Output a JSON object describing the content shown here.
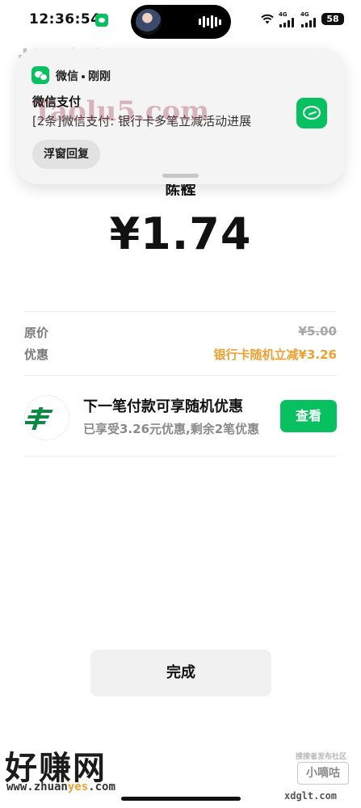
{
  "status_bar": {
    "time": "12:36:54",
    "battery": "58",
    "network_1": "4G",
    "network_2": "4G"
  },
  "notification": {
    "app_name": "微信",
    "time_label": "刚刚",
    "title": "微信支付",
    "body": "[2条]微信支付: 银行卡多笔立减活动进展",
    "reply_label": "浮窗回复"
  },
  "payment": {
    "merchant_partial": "陈辉",
    "amount": "¥1.74",
    "original_label": "原价",
    "original_value": "¥5.00",
    "discount_label": "优惠",
    "discount_value": "银行卡随机立减¥3.26"
  },
  "promo": {
    "title": "下一笔付款可享随机优惠",
    "subtitle": "已享受3.26元优惠,剩余2笔优惠",
    "button_label": "查看"
  },
  "done_button": "完成",
  "watermarks": {
    "top": "找线报",
    "taolu": "Taolu5.com",
    "haozhuan": "好赚网",
    "zhuanyes_prefix": "www.zhuan",
    "zhuanyes_highlight": "yes",
    "zhuanyes_suffix": ".com",
    "xiaodigu_caption": "搜搜者发布社区",
    "xiaodigu": "小嘀咕",
    "xdglt": "xdglt.com"
  },
  "colors": {
    "wechat_green": "#07c160",
    "discount_orange": "#f0a030"
  }
}
